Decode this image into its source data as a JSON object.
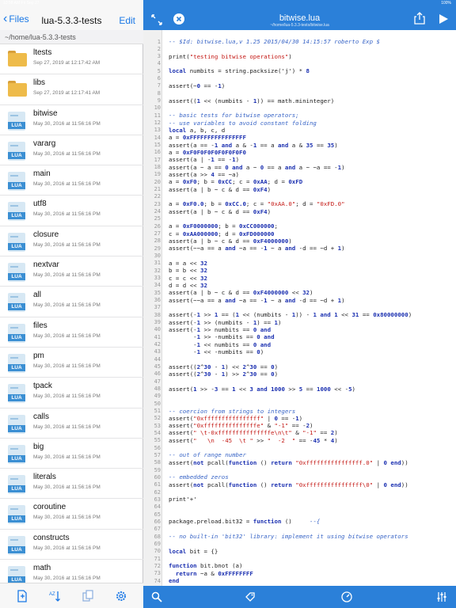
{
  "status": {
    "left": "10:58 AM  Fri Sep 27",
    "right": "100%"
  },
  "sidebar": {
    "back_label": "Files",
    "title": "lua-5.3.3-tests",
    "edit_label": "Edit",
    "path": "~/home/lua-5.3.3-tests",
    "files": [
      {
        "name": "ltests",
        "date": "Sep 27, 2019 at 12:17:42 AM",
        "type": "folder"
      },
      {
        "name": "libs",
        "date": "Sep 27, 2019 at 12:17:41 AM",
        "type": "folder"
      },
      {
        "name": "bitwise",
        "date": "May 30, 2016 at 11:56:16 PM",
        "type": "lua"
      },
      {
        "name": "vararg",
        "date": "May 30, 2016 at 11:56:16 PM",
        "type": "lua"
      },
      {
        "name": "main",
        "date": "May 30, 2016 at 11:56:16 PM",
        "type": "lua"
      },
      {
        "name": "utf8",
        "date": "May 30, 2016 at 11:56:16 PM",
        "type": "lua"
      },
      {
        "name": "closure",
        "date": "May 30, 2016 at 11:56:16 PM",
        "type": "lua"
      },
      {
        "name": "nextvar",
        "date": "May 30, 2016 at 11:56:16 PM",
        "type": "lua"
      },
      {
        "name": "all",
        "date": "May 30, 2016 at 11:56:16 PM",
        "type": "lua"
      },
      {
        "name": "files",
        "date": "May 30, 2016 at 11:56:16 PM",
        "type": "lua"
      },
      {
        "name": "pm",
        "date": "May 30, 2016 at 11:56:16 PM",
        "type": "lua"
      },
      {
        "name": "tpack",
        "date": "May 30, 2016 at 11:56:16 PM",
        "type": "lua"
      },
      {
        "name": "calls",
        "date": "May 30, 2016 at 11:56:16 PM",
        "type": "lua"
      },
      {
        "name": "big",
        "date": "May 30, 2016 at 11:56:16 PM",
        "type": "lua"
      },
      {
        "name": "literals",
        "date": "May 30, 2016 at 11:56:16 PM",
        "type": "lua"
      },
      {
        "name": "coroutine",
        "date": "May 30, 2016 at 11:56:16 PM",
        "type": "lua"
      },
      {
        "name": "constructs",
        "date": "May 30, 2016 at 11:56:16 PM",
        "type": "lua"
      },
      {
        "name": "math",
        "date": "May 30, 2016 at 11:56:16 PM",
        "type": "lua"
      }
    ],
    "file_icon_label": "LUA"
  },
  "editor": {
    "title": "bitwise.lua",
    "subtitle": "~/home/lua-5.3.3-tests/bitwise.lua",
    "lines": [
      "-- $Id: bitwise.lua,v 1.25 2015/04/30 14:15:57 roberto Exp $",
      "",
      "print(\"testing bitwise operations\")",
      "",
      "local numbits = string.packsize('j') * 8",
      "",
      "assert(~0 == -1)",
      "",
      "assert((1 << (numbits - 1)) == math.mininteger)",
      "",
      "-- basic tests for bitwise operators;",
      "-- use variables to avoid constant folding",
      "local a, b, c, d",
      "a = 0xFFFFFFFFFFFFFFFF",
      "assert(a == -1 and a & -1 == a and a & 35 == 35)",
      "a = 0xF0F0F0F0F0F0F0F0",
      "assert(a | -1 == -1)",
      "assert(a ~ a == 0 and a ~ 0 == a and a ~ ~a == -1)",
      "assert(a >> 4 == ~a)",
      "a = 0xF0; b = 0xCC; c = 0xAA; d = 0xFD",
      "assert(a | b ~ c & d == 0xF4)",
      "",
      "a = 0xF0.0; b = 0xCC.0; c = \"0xAA.0\"; d = \"0xFD.0\"",
      "assert(a | b ~ c & d == 0xF4)",
      "",
      "a = 0xF0000000; b = 0xCC000000;",
      "c = 0xAA000000; d = 0xFD000000",
      "assert(a | b ~ c & d == 0xF4000000)",
      "assert(~~a == a and ~a == -1 ~ a and -d == ~d + 1)",
      "",
      "a = a << 32",
      "b = b << 32",
      "c = c << 32",
      "d = d << 32",
      "assert(a | b ~ c & d == 0xF4000000 << 32)",
      "assert(~~a == a and ~a == -1 ~ a and -d == ~d + 1)",
      "",
      "assert(-1 >> 1 == (1 << (numbits - 1)) - 1 and 1 << 31 == 0x80000000)",
      "assert(-1 >> (numbits - 1) == 1)",
      "assert(-1 >> numbits == 0 and",
      "       -1 >> -numbits == 0 and",
      "       -1 << numbits == 0 and",
      "       -1 << -numbits == 0)",
      "",
      "assert((2^30 - 1) << 2^30 == 0)",
      "assert((2^30 - 1) >> 2^30 == 0)",
      "",
      "assert(1 >> -3 == 1 << 3 and 1000 >> 5 == 1000 << -5)",
      "",
      "",
      "-- coercion from strings to integers",
      "assert(\"0xffffffffffffffff\" | 0 == -1)",
      "assert(\"0xfffffffffffffffe\" & \"-1\" == -2)",
      "assert(\" \\t-0xfffffffffffffffe\\n\\t\" & \"-1\" == 2)",
      "assert(\"   \\n  -45  \\t \" >> \"  -2  \" == -45 * 4)",
      "",
      "-- out of range number",
      "assert(not pcall(function () return \"0xffffffffffffffff.0\" | 0 end))",
      "",
      "-- embedded zeros",
      "assert(not pcall(function () return \"0xffffffffffffffff\\0\" | 0 end))",
      "",
      "print'+'",
      "",
      "",
      "package.preload.bit32 = function ()     --{",
      "",
      "-- no built-in 'bit32' library: implement it using bitwise operators",
      "",
      "local bit = {}",
      "",
      "function bit.bnot (a)",
      "  return ~a & 0xFFFFFFFF",
      "end"
    ]
  },
  "colors": {
    "accent": "#2b80d9",
    "link": "#1a78e6",
    "comment": "#3a66c7",
    "keyword": "#1a2fb0",
    "string": "#c41a16"
  }
}
